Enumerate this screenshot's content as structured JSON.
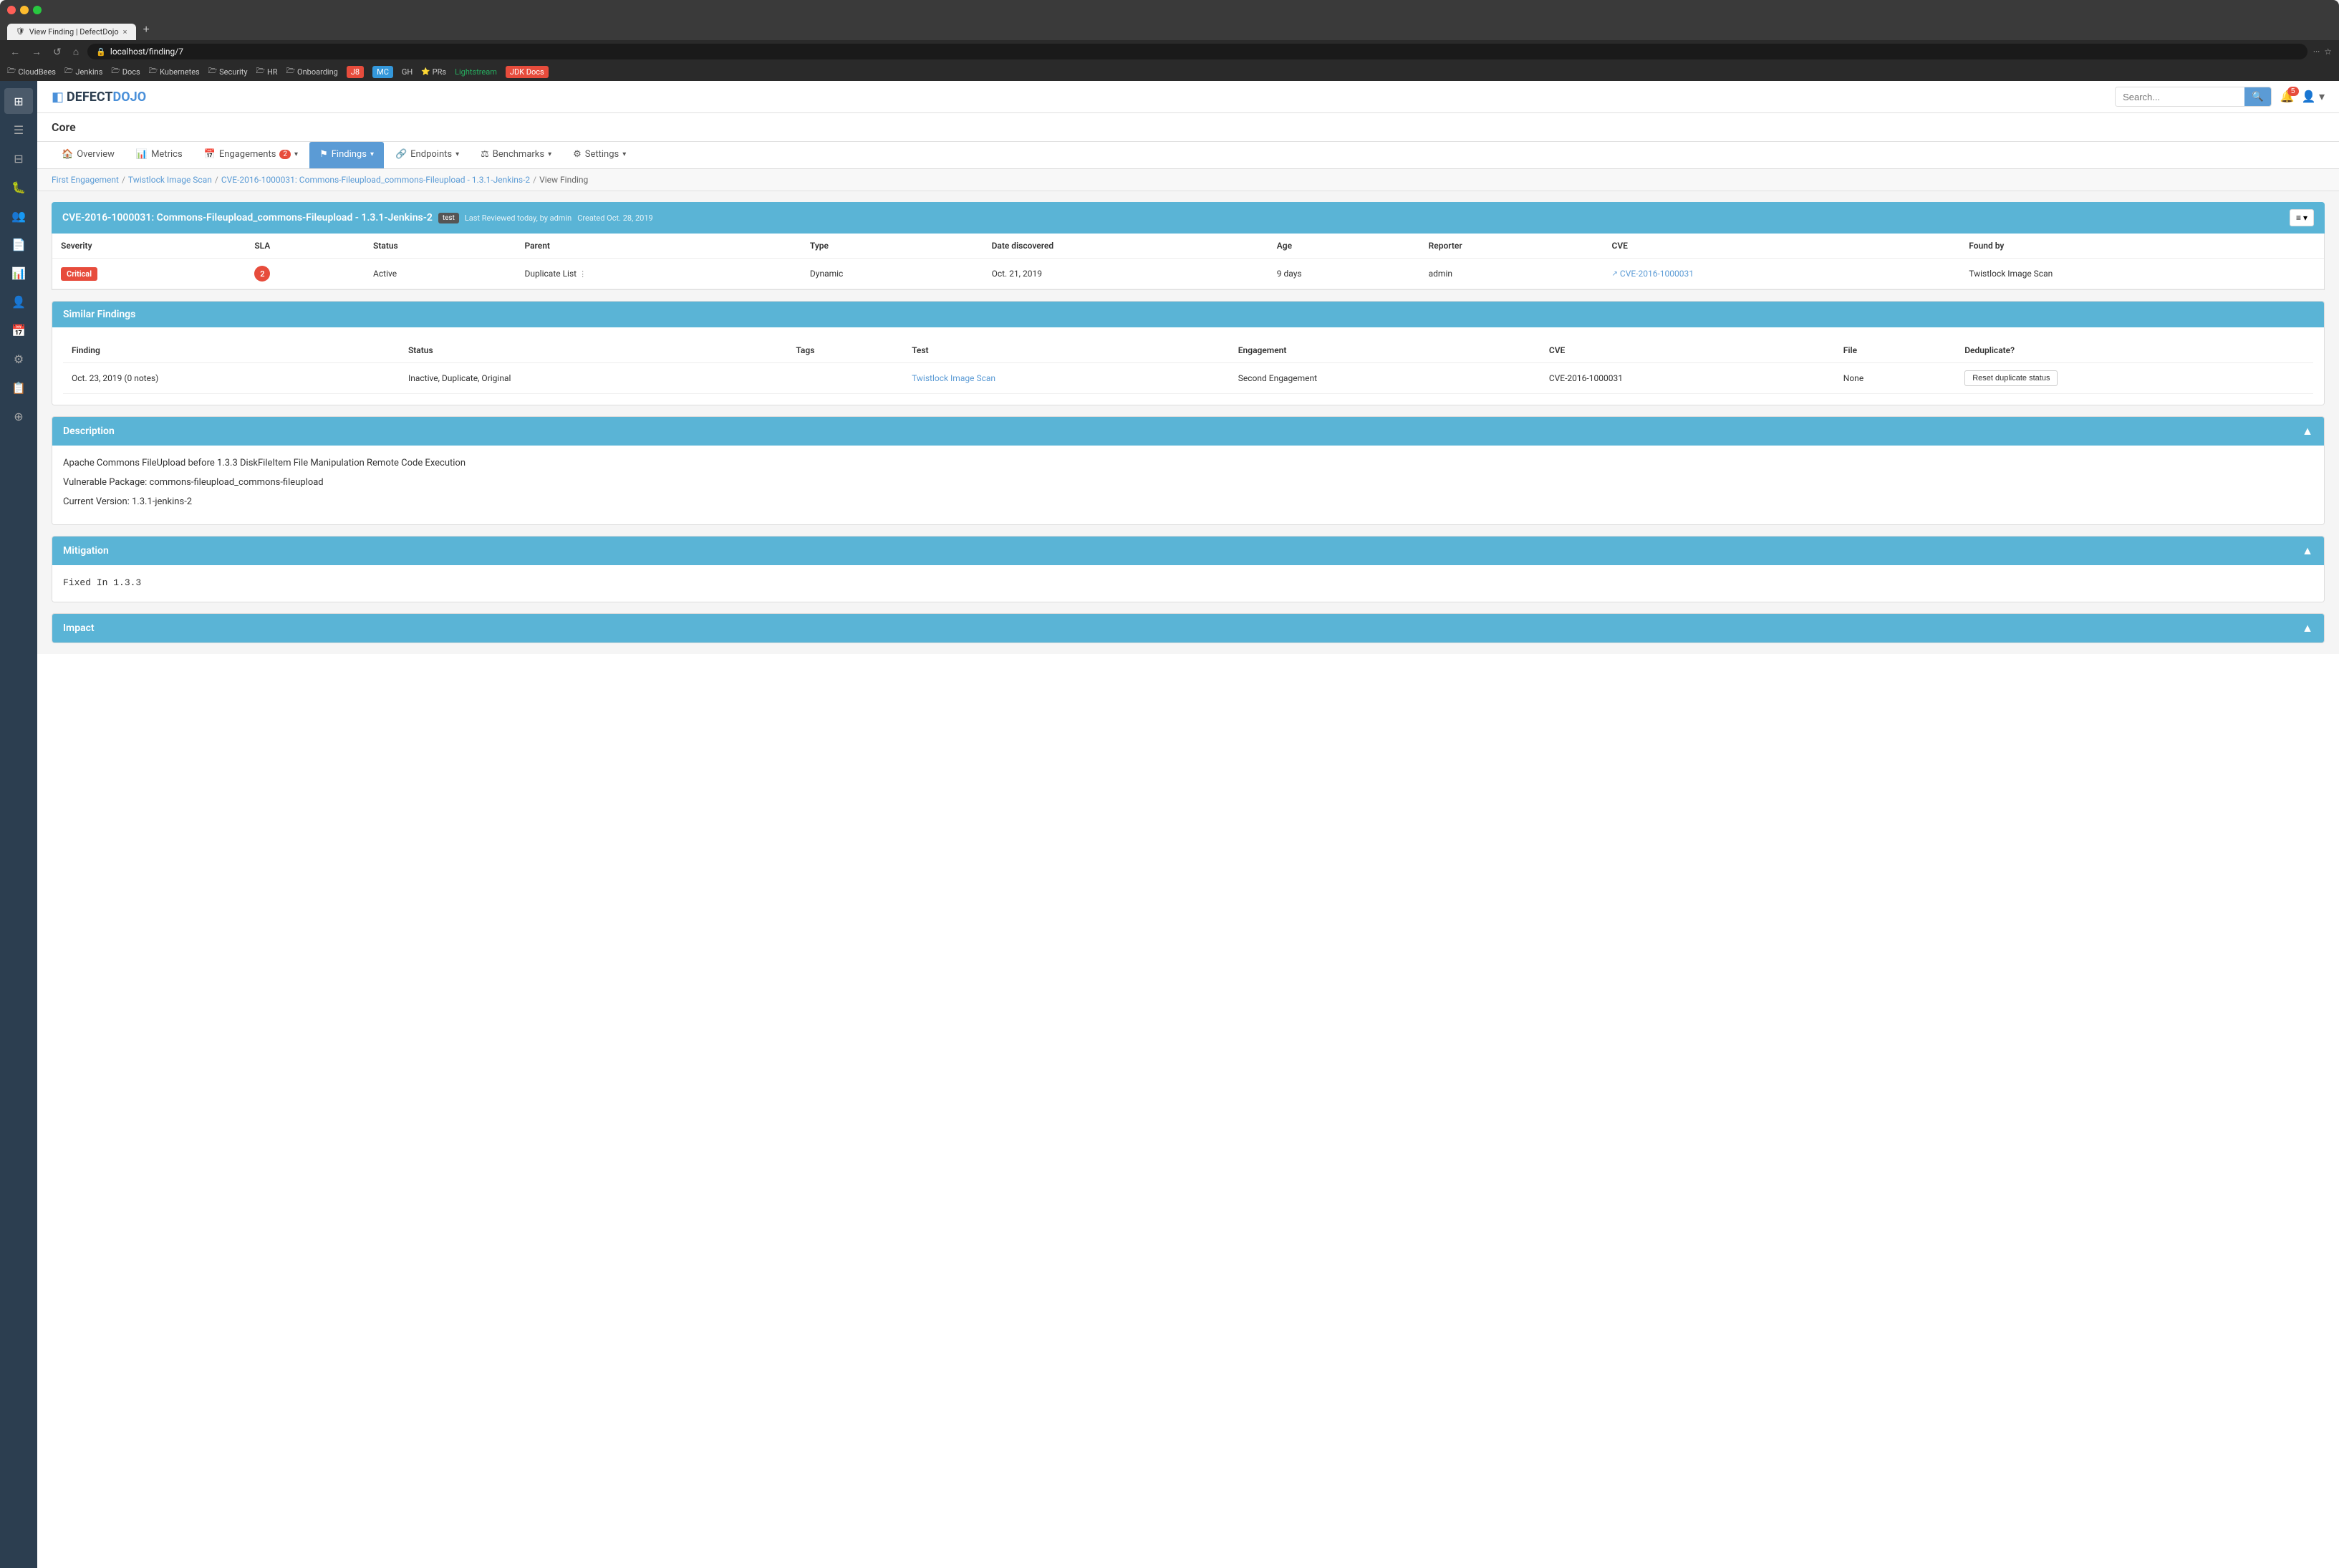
{
  "browser": {
    "tab_title": "View Finding | DefectDojo",
    "tab_favicon": "🛡",
    "url": "localhost/finding/7",
    "new_tab_label": "+",
    "close_tab_label": "×",
    "nav": {
      "back": "←",
      "forward": "→",
      "reload": "↺",
      "home": "⌂"
    }
  },
  "bookmarks": [
    {
      "id": "cloudbees",
      "icon": "🗁",
      "label": "CloudBees"
    },
    {
      "id": "jenkins",
      "icon": "🗁",
      "label": "Jenkins"
    },
    {
      "id": "docs",
      "icon": "🗁",
      "label": "Docs"
    },
    {
      "id": "kubernetes",
      "icon": "🗁",
      "label": "Kubernetes"
    },
    {
      "id": "security",
      "icon": "🗁",
      "label": "Security"
    },
    {
      "id": "hr",
      "icon": "🗁",
      "label": "HR"
    },
    {
      "id": "onboarding",
      "icon": "🗁",
      "label": "Onboarding"
    },
    {
      "id": "j8",
      "icon": "🔴",
      "label": "J8"
    },
    {
      "id": "mc",
      "icon": "🔵",
      "label": "MC"
    },
    {
      "id": "gh",
      "icon": "⚫",
      "label": "GH"
    },
    {
      "id": "prs",
      "icon": "⭐",
      "label": "PRs"
    },
    {
      "id": "lightstream",
      "icon": "🟢",
      "label": "Lightstream"
    },
    {
      "id": "jdk_docs",
      "icon": "🔴",
      "label": "JDK Docs"
    }
  ],
  "sidebar": {
    "items": [
      {
        "id": "dashboard",
        "icon": "⊞",
        "label": "Dashboard"
      },
      {
        "id": "findings",
        "icon": "☰",
        "label": "Findings"
      },
      {
        "id": "inbox",
        "icon": "⊟",
        "label": "Inbox"
      },
      {
        "id": "bugs",
        "icon": "🐛",
        "label": "Bugs"
      },
      {
        "id": "team",
        "icon": "👥",
        "label": "Team"
      },
      {
        "id": "documents",
        "icon": "📄",
        "label": "Documents"
      },
      {
        "id": "reports",
        "icon": "📊",
        "label": "Reports"
      },
      {
        "id": "users",
        "icon": "👤",
        "label": "Users"
      },
      {
        "id": "calendar",
        "icon": "📅",
        "label": "Calendar"
      },
      {
        "id": "settings",
        "icon": "⚙",
        "label": "Settings"
      },
      {
        "id": "compliance",
        "icon": "📋",
        "label": "Compliance"
      },
      {
        "id": "plugins",
        "icon": "⊕",
        "label": "Plugins"
      }
    ]
  },
  "header": {
    "brand": "DefectDojo",
    "search_placeholder": "Search...",
    "notifications_count": "5",
    "notification_icon": "🔔",
    "user_icon": "👤"
  },
  "page": {
    "title": "Core",
    "tabs": [
      {
        "id": "overview",
        "label": "Overview",
        "icon": "🏠",
        "active": false,
        "badge": null
      },
      {
        "id": "metrics",
        "label": "Metrics",
        "icon": "📊",
        "active": false,
        "badge": null
      },
      {
        "id": "engagements",
        "label": "Engagements",
        "icon": "📅",
        "active": false,
        "badge": "2"
      },
      {
        "id": "findings",
        "label": "Findings",
        "icon": "⚑",
        "active": true,
        "badge": null
      },
      {
        "id": "endpoints",
        "label": "Endpoints",
        "icon": "🔗",
        "active": false,
        "badge": null
      },
      {
        "id": "benchmarks",
        "label": "Benchmarks",
        "icon": "⚖",
        "active": false,
        "badge": null
      },
      {
        "id": "settings",
        "label": "Settings",
        "icon": "⚙",
        "active": false,
        "badge": null
      }
    ],
    "breadcrumb": [
      {
        "label": "First Engagement",
        "link": true
      },
      {
        "label": "Twistlock Image Scan",
        "link": true
      },
      {
        "label": "CVE-2016-1000031: Commons-Fileupload_commons-Fileupload - 1.3.1-Jenkins-2",
        "link": true
      },
      {
        "label": "View Finding",
        "link": false
      }
    ]
  },
  "finding": {
    "title": "CVE-2016-1000031: Commons-Fileupload_commons-Fileupload - 1.3.1-Jenkins-2",
    "tag": "test",
    "last_reviewed": "Last Reviewed today, by admin",
    "created": "Created Oct. 28, 2019",
    "actions_icon": "≡",
    "columns": {
      "severity": "Severity",
      "sla": "SLA",
      "status": "Status",
      "parent": "Parent",
      "type": "Type",
      "date_discovered": "Date discovered",
      "age": "Age",
      "reporter": "Reporter",
      "cve": "CVE",
      "found_by": "Found by"
    },
    "row": {
      "severity": "Critical",
      "sla": "2",
      "status": "Active",
      "parent": "Duplicate List",
      "type": "Dynamic",
      "date_discovered": "Oct. 21, 2019",
      "age": "9 days",
      "reporter": "admin",
      "cve_id": "CVE-2016-1000031",
      "cve_link": "#",
      "found_by": "Twistlock Image Scan"
    }
  },
  "similar_findings": {
    "section_title": "Similar Findings",
    "columns": {
      "finding": "Finding",
      "status": "Status",
      "tags": "Tags",
      "test": "Test",
      "engagement": "Engagement",
      "cve": "CVE",
      "file": "File",
      "deduplicate": "Deduplicate?"
    },
    "rows": [
      {
        "finding": "Oct. 23, 2019 (0 notes)",
        "status": "Inactive, Duplicate, Original",
        "tags": "",
        "test": "Twistlock Image Scan",
        "engagement": "Second Engagement",
        "cve": "CVE-2016-1000031",
        "file": "None",
        "deduplicate_label": "Reset duplicate status"
      }
    ]
  },
  "description": {
    "section_title": "Description",
    "lines": [
      "Apache Commons FileUpload before 1.3.3 DiskFileItem File Manipulation Remote Code Execution",
      "Vulnerable Package: commons-fileupload_commons-fileupload",
      "Current Version: 1.3.1-jenkins-2"
    ]
  },
  "mitigation": {
    "section_title": "Mitigation",
    "text": "Fixed In 1.3.3"
  },
  "impact": {
    "section_title": "Impact"
  },
  "colors": {
    "primary_blue": "#5ab4d6",
    "accent_blue": "#5b9bd5",
    "critical_red": "#e74c3c",
    "sidebar_bg": "#2c3e50",
    "browser_bg": "#3a3a3a"
  }
}
